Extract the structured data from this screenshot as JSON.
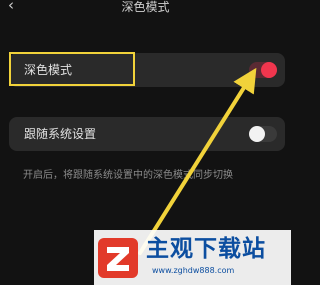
{
  "header": {
    "back_icon": "chevron-left-icon",
    "back_glyph": "‹",
    "title": "深色模式"
  },
  "settings": {
    "dark_mode": {
      "label": "深色模式",
      "enabled": true
    },
    "follow_system": {
      "label": "跟随系统设置",
      "enabled": false
    }
  },
  "hint": "开启后，将跟随系统设置中的深色模式同步切换",
  "annotation": {
    "color": "#f1d23a"
  },
  "colors": {
    "accent": "#f0364e",
    "background": "#121212",
    "card": "#2a2a2a"
  },
  "watermark": {
    "name": "主观下载站",
    "url": "www.zghdw888.com"
  }
}
